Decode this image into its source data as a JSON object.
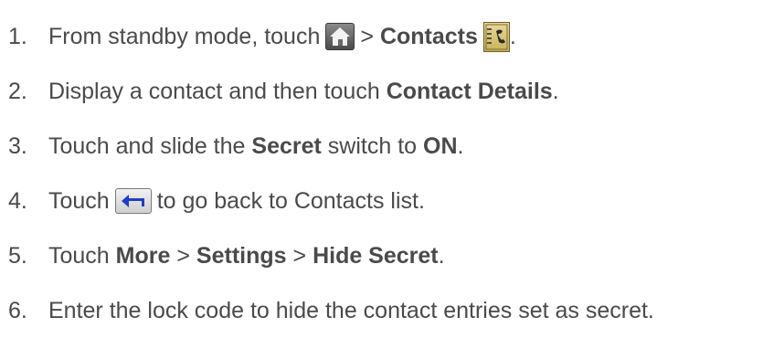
{
  "steps": [
    {
      "number": "1.",
      "text_before": "From standby mode, touch",
      "icon_home": "home-icon",
      "sep": ">",
      "bold_contacts": "Contacts",
      "icon_contacts": "contacts-icon",
      "tail": "."
    },
    {
      "number": "2.",
      "text_before": "Display a contact and then touch",
      "bold": "Contact Details",
      "tail": "."
    },
    {
      "number": "3.",
      "text_before": "Touch and slide the",
      "bold_secret": "Secret",
      "text_middle": "switch to",
      "bold_on": "ON",
      "tail": "."
    },
    {
      "number": "4.",
      "text_before": "Touch",
      "icon_back": "back-icon",
      "text_after": "to go back to Contacts list."
    },
    {
      "number": "5.",
      "text_before": "Touch",
      "bold_more": "More",
      "sep1": ">",
      "bold_settings": "Settings",
      "sep2": ">",
      "bold_hide": "Hide Secret",
      "tail": "."
    },
    {
      "number": "6.",
      "text": "Enter the lock code to hide the contact entries set as secret."
    }
  ],
  "colors": {
    "text": "#4a4a4a",
    "home_icon_bg": "#6f6f6f",
    "contacts_icon_bg": "#d8c57a",
    "back_icon_bg": "#e3e3e3",
    "back_arrow": "#1f3fc1"
  }
}
